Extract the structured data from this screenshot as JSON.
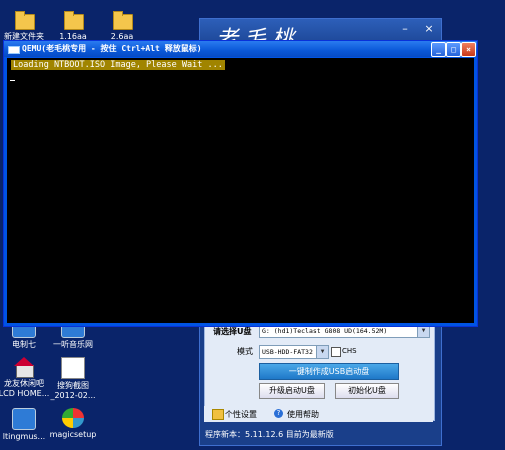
{
  "desktop": {
    "icons": [
      {
        "label": "新建文件夹",
        "glyph": "folder-icon"
      },
      {
        "label": "1.16aa",
        "glyph": "folder-icon"
      },
      {
        "label": "2.6aa",
        "glyph": "folder-icon"
      },
      {
        "label": "电制七",
        "glyph": "app-icon"
      },
      {
        "label": "一听音乐网",
        "glyph": "app-icon"
      },
      {
        "label": "龙友休闲吧",
        "label2": "LCD HOME...",
        "glyph": "house-icon"
      },
      {
        "label": "搜狗截图",
        "label2": "_2012-02...",
        "glyph": "document-icon"
      },
      {
        "label": "ltingmus...",
        "glyph": "app-icon"
      },
      {
        "label": "magicsetup",
        "glyph": "ball-icon"
      }
    ]
  },
  "qemu": {
    "title": "QEMU(老毛桃专用 - 按住 Ctrl+Alt 释放鼠标)",
    "console_line": "Loading NTBOOT.ISO Image, Please Wait ...",
    "cursor": "_",
    "buttons": {
      "minimize": "_",
      "maximize": "□",
      "close": "×"
    }
  },
  "tool": {
    "brand": "老毛桃",
    "titlebar": {
      "minimize": "–",
      "close": "×"
    },
    "select_disk_label": "请选择U盘",
    "select_disk_value": "G: (hd1)Teclast G808 UD(164.52M)",
    "mode_label": "模式",
    "mode_value": "USB-HDD-FAT32",
    "chs_label": "CHS",
    "make_button": "一键制作成USB启动盘",
    "upgrade_button": "升级启动U盘",
    "init_button": "初始化U盘",
    "personal_settings": "个性设置",
    "help": "使用帮助",
    "status": "程序新本：5.11.12.6    目前为最新版"
  }
}
